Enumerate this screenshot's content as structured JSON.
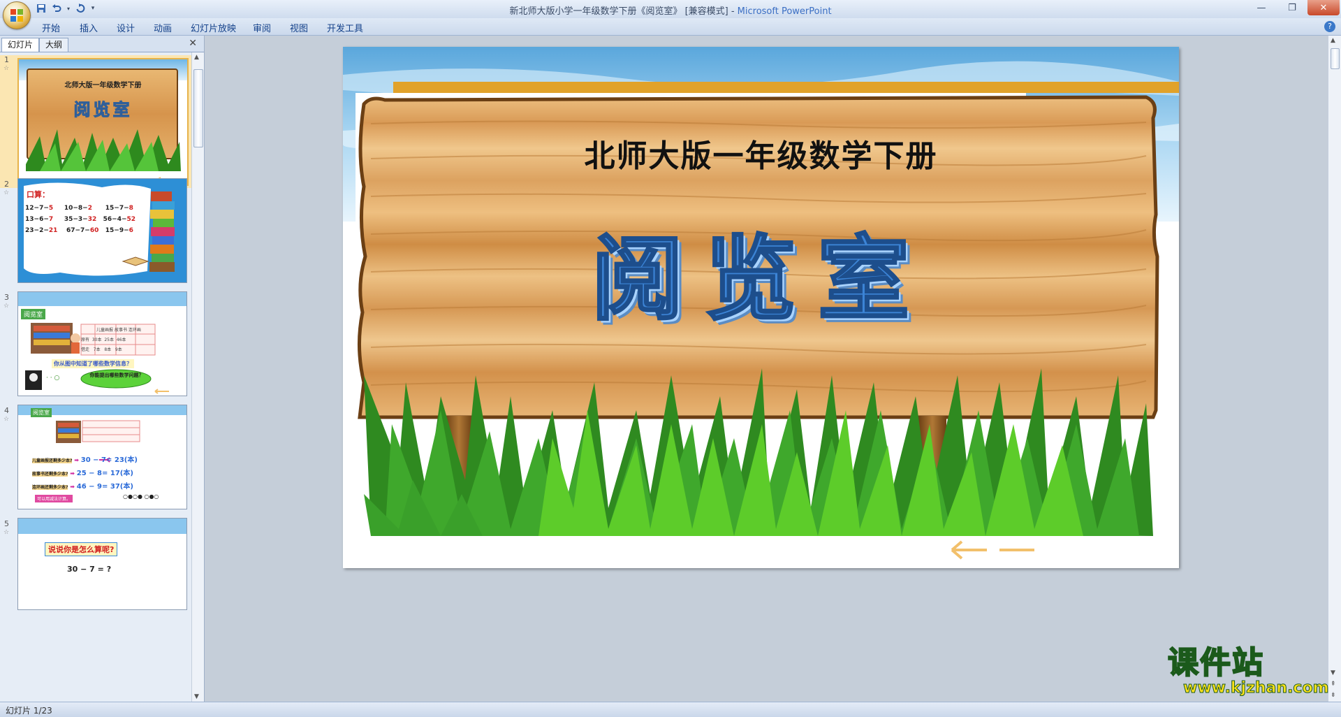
{
  "window": {
    "title": "新北师大版小学一年级数学下册《阅览室》 [兼容模式] - ",
    "app_name": "Microsoft PowerPoint"
  },
  "ribbon": {
    "tabs": [
      "开始",
      "插入",
      "设计",
      "动画",
      "幻灯片放映",
      "审阅",
      "视图",
      "开发工具"
    ]
  },
  "panel": {
    "tab_slides": "幻灯片",
    "tab_outline": "大纲"
  },
  "thumbs": {
    "t1": {
      "num": "1",
      "title": "北师大版一年级数学下册",
      "word": "阅览室"
    },
    "t2": {
      "num": "2",
      "heading": "口算：",
      "rows": [
        [
          "12−7−",
          "5",
          "10−8−",
          "2",
          "15−7−",
          "8"
        ],
        [
          "13−6−",
          "7",
          "35−3−",
          "32",
          "56−4−",
          "52"
        ],
        [
          "23−2−",
          "21",
          "67−7−",
          "60",
          "15−9−",
          "6"
        ]
      ]
    },
    "t3": {
      "num": "3",
      "label": "阅览室",
      "table_head": [
        "儿童画报",
        "故事书",
        "连环画"
      ],
      "row1": [
        "原有",
        "30本",
        "25本",
        "46本"
      ],
      "row2": [
        "借走",
        "7本",
        "8本",
        "9本"
      ],
      "question": "你从图中知道了哪些数学信息？",
      "bubble": "你能提出哪些数学问题？",
      "dots": "· · ○"
    },
    "t4": {
      "num": "4",
      "label": "阅览室",
      "q1": "儿童画报还剩多少本?",
      "a1": "30 − 7= 23(本)",
      "q2": "故事书还剩多少本?",
      "a2": "25 − 8= 17(本)",
      "q3": "连环画还剩多少本?",
      "a3": "46 − 9= 37(本)",
      "note": "可以用减法计算。",
      "dots": "○●○● ○●○"
    },
    "t5": {
      "num": "5",
      "heading": "说说你是怎么算呢?",
      "expr": "30 − 7 = ?"
    }
  },
  "slide": {
    "title": "北师大版一年级数学下册",
    "word": "阅览室"
  },
  "status": {
    "text": "幻灯片 1/23"
  },
  "watermark": {
    "text": "课件站",
    "url": "www.kjzhan.com"
  }
}
